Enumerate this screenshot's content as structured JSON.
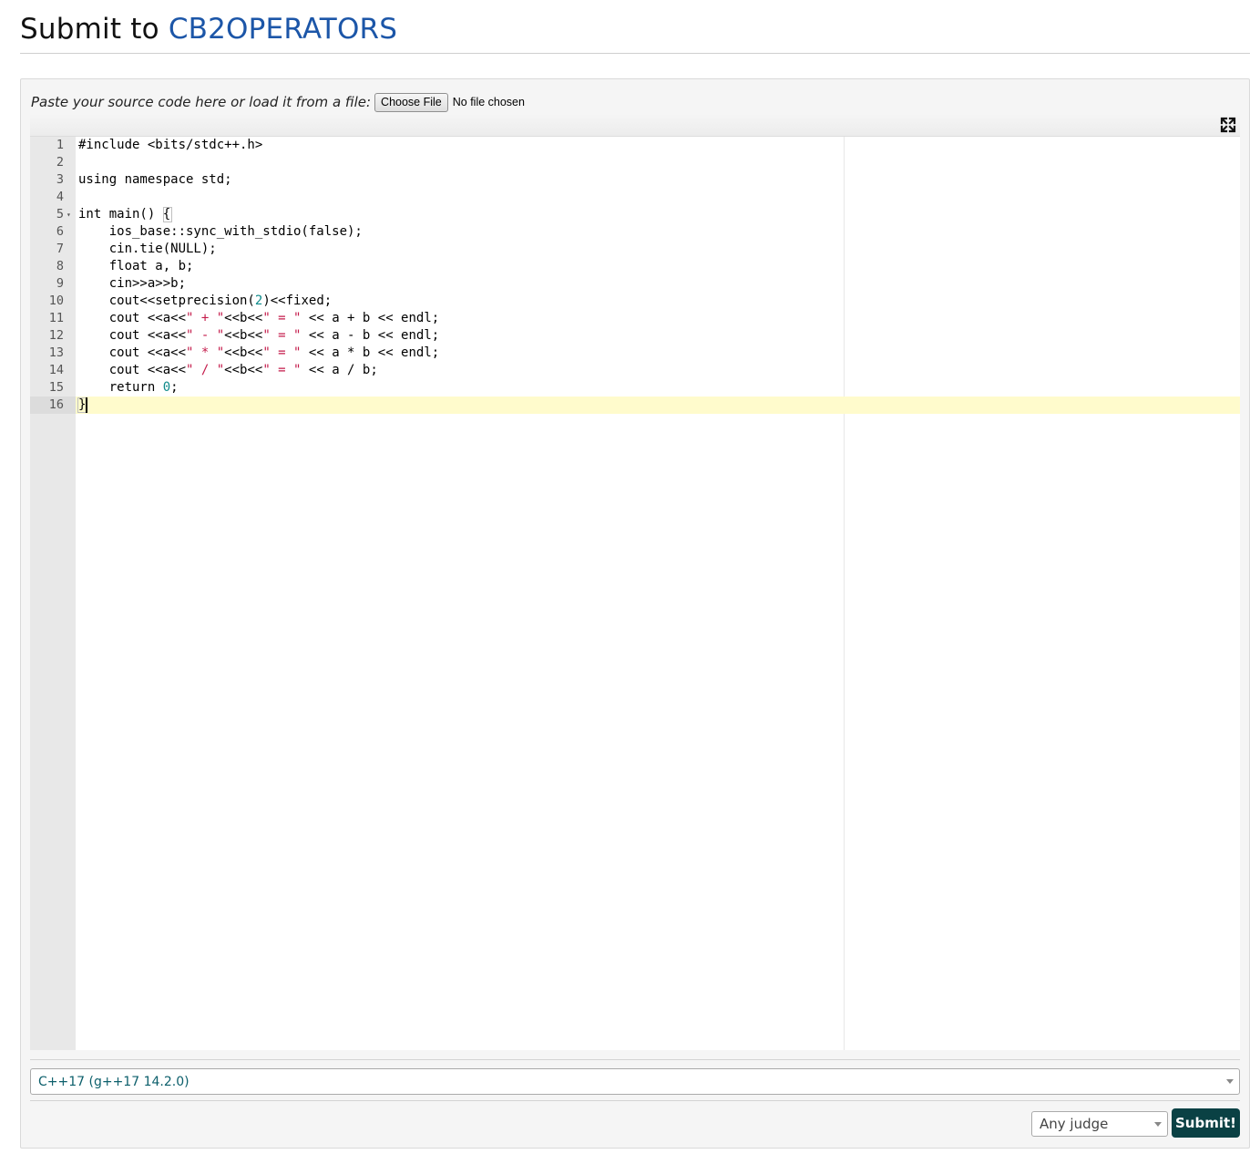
{
  "header": {
    "title_prefix": "Submit to ",
    "problem_code": "CB2OPERATORS"
  },
  "file_loader": {
    "label": "Paste your source code here or load it from a file:",
    "button_label": "Choose File",
    "status": "No file chosen"
  },
  "editor": {
    "active_line": 16,
    "lines": [
      {
        "n": "1",
        "text": "#include <bits/stdc++.h>"
      },
      {
        "n": "2",
        "text": ""
      },
      {
        "n": "3",
        "text": "using namespace std;"
      },
      {
        "n": "4",
        "text": ""
      },
      {
        "n": "5",
        "text": "int main() {"
      },
      {
        "n": "6",
        "text": "    ios_base::sync_with_stdio(false);"
      },
      {
        "n": "7",
        "text": "    cin.tie(NULL);"
      },
      {
        "n": "8",
        "text": "    float a, b;"
      },
      {
        "n": "9",
        "text": "    cin>>a>>b;"
      },
      {
        "n": "10",
        "text": "    cout<<setprecision(2)<<fixed;"
      },
      {
        "n": "11",
        "text": "    cout <<a<<\" + \"<<b<<\" = \" << a + b << endl;"
      },
      {
        "n": "12",
        "text": "    cout <<a<<\" - \"<<b<<\" = \" << a - b << endl;"
      },
      {
        "n": "13",
        "text": "    cout <<a<<\" * \"<<b<<\" = \" << a * b << endl;"
      },
      {
        "n": "14",
        "text": "    cout <<a<<\" / \"<<b<<\" = \" << a / b;"
      },
      {
        "n": "15",
        "text": "    return 0;"
      },
      {
        "n": "16",
        "text": "}"
      }
    ],
    "colors": {
      "string": "#c41a4a",
      "number": "#0e8a8a",
      "active_line_bg": "#fffbcc"
    }
  },
  "language": {
    "selected": "C++17 (g++17 14.2.0)"
  },
  "judge": {
    "selected": "Any judge"
  },
  "submit": {
    "label": "Submit!"
  },
  "colors": {
    "problem_link": "#1c56a8",
    "submit_bg": "#0a4144",
    "language_text": "#0c5f6b"
  }
}
